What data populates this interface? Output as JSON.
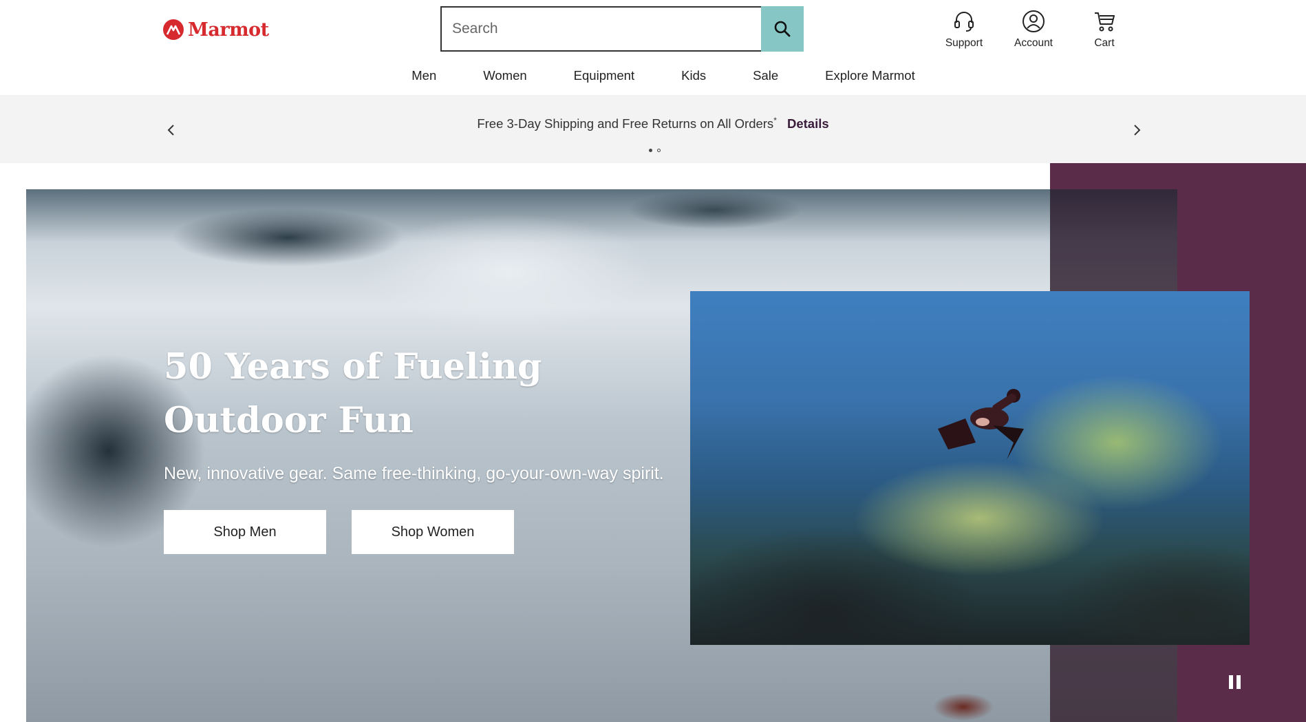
{
  "brand": {
    "name": "Marmot",
    "color": "#d62a2f"
  },
  "search": {
    "placeholder": "Search",
    "button_icon": "search-icon",
    "button_color": "#86c7c6"
  },
  "utility": [
    {
      "label": "Support",
      "icon": "headset-icon"
    },
    {
      "label": "Account",
      "icon": "user-circle-icon"
    },
    {
      "label": "Cart",
      "icon": "cart-icon"
    }
  ],
  "nav": [
    "Men",
    "Women",
    "Equipment",
    "Kids",
    "Sale",
    "Explore Marmot"
  ],
  "promo": {
    "text": "Free 3-Day Shipping and Free Returns on All Orders",
    "asterisk": "*",
    "link": "Details",
    "slide_count": 2,
    "active_slide": 1
  },
  "hero": {
    "title_line1": "50 Years of Fueling",
    "title_line2": "Outdoor Fun",
    "subtitle": "New, innovative gear. Same free-thinking, go-your-own-way spirit.",
    "cta_men": "Shop Men",
    "cta_women": "Shop Women",
    "accent_color": "#5a2c4a",
    "pause_icon": "pause-icon"
  }
}
